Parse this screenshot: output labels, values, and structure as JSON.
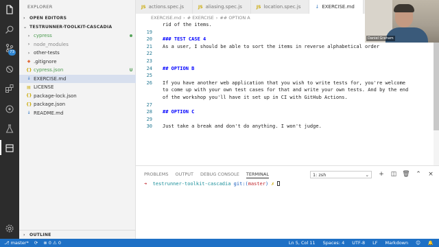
{
  "activity_bar": {
    "icons": [
      "files-icon",
      "search-icon",
      "source-control-icon",
      "debug-icon",
      "extensions-icon",
      "remote-icon",
      "test-icon"
    ],
    "source_control_badge": "73",
    "bottom_icon": "gear-icon"
  },
  "sidebar": {
    "title": "EXPLORER",
    "open_editors": "OPEN EDITORS",
    "project": "TESTRUNNER-TOOLKIT-CASCADIA",
    "items": [
      {
        "name": "cypress",
        "kind": "folder",
        "color": "#4a9a4d",
        "status": "dot"
      },
      {
        "name": "node_modules",
        "kind": "folder",
        "color": "#8a8a8a",
        "status": ""
      },
      {
        "name": "other-tests",
        "kind": "folder",
        "color": "#333333",
        "status": ""
      },
      {
        "name": ".gitignore",
        "kind": "git",
        "color": "#333333",
        "status": ""
      },
      {
        "name": "cypress.json",
        "kind": "json",
        "color": "#4a9a4d",
        "status": "U"
      },
      {
        "name": "EXERCISE.md",
        "kind": "md",
        "color": "#333333",
        "status": ""
      },
      {
        "name": "LICENSE",
        "kind": "license",
        "color": "#333333",
        "status": ""
      },
      {
        "name": "package-lock.json",
        "kind": "json",
        "color": "#333333",
        "status": ""
      },
      {
        "name": "package.json",
        "kind": "json",
        "color": "#333333",
        "status": ""
      },
      {
        "name": "README.md",
        "kind": "md",
        "color": "#333333",
        "status": ""
      }
    ],
    "outline": "OUTLINE"
  },
  "tabs": [
    {
      "label": "actions.spec.js",
      "kind": "js"
    },
    {
      "label": "aliasing.spec.js",
      "kind": "js"
    },
    {
      "label": "location.spec.js",
      "kind": "js"
    },
    {
      "label": "EXERCISE.md",
      "kind": "md"
    }
  ],
  "breadcrumb": [
    "EXERCISE.md",
    "# EXERCISE",
    "## OPTION A"
  ],
  "editor": {
    "lines": [
      {
        "num": "",
        "text": "rid of the items.",
        "heading": false
      },
      {
        "num": "19",
        "text": "",
        "heading": false
      },
      {
        "num": "20",
        "text": "### TEST CASE 4",
        "heading": true
      },
      {
        "num": "21",
        "text": "As a user, I should be able to sort the items in reverse alphabetical order",
        "heading": false
      },
      {
        "num": "22",
        "text": "",
        "heading": false
      },
      {
        "num": "23",
        "text": "",
        "heading": false
      },
      {
        "num": "24",
        "text": "## OPTION B",
        "heading": true
      },
      {
        "num": "25",
        "text": "",
        "heading": false
      },
      {
        "num": "26",
        "text": "If you have another web application that you wish to write tests for, you're welcome",
        "heading": false
      },
      {
        "num": "",
        "text": "to come up with your own test cases for that and write your own tests. And by the end",
        "heading": false
      },
      {
        "num": "",
        "text": "of the workshop you'll have it set up in CI with GitHub Actions.",
        "heading": false
      },
      {
        "num": "27",
        "text": "",
        "heading": false
      },
      {
        "num": "28",
        "text": "## OPTION C",
        "heading": true
      },
      {
        "num": "29",
        "text": "",
        "heading": false
      },
      {
        "num": "30",
        "text": "Just take a break and don't do anything. I won't judge.",
        "heading": false
      }
    ]
  },
  "panel": {
    "tabs": [
      "PROBLEMS",
      "OUTPUT",
      "DEBUG CONSOLE",
      "TERMINAL"
    ],
    "terminal_select": "1: zsh",
    "terminal": {
      "arrow": "➜",
      "dir": "testrunner-toolkit-cascadia",
      "git_label": "git:(",
      "branch": "master",
      "git_close": ")",
      "dirty": "✗"
    }
  },
  "statusbar": {
    "branch": "master*",
    "errors": "0",
    "warnings": "0",
    "position": "Ln 5, Col 11",
    "spaces": "Spaces: 4",
    "encoding": "UTF-8",
    "eol": "LF",
    "language": "Markdown"
  },
  "webcam": {
    "name": "Daniel Graham"
  }
}
